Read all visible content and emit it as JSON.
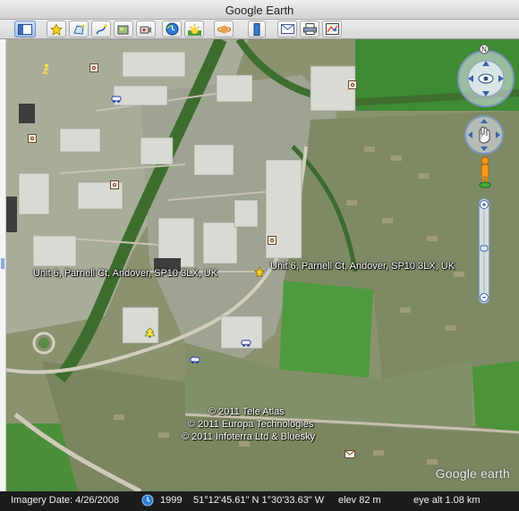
{
  "window": {
    "title": "Google Earth"
  },
  "toolbar": {
    "buttons": [
      {
        "name": "sidebar",
        "icon": "sidebar-icon"
      },
      {
        "name": "add-placemark",
        "icon": "pushpin-icon"
      },
      {
        "name": "add-polygon",
        "icon": "polygon-icon"
      },
      {
        "name": "add-path",
        "icon": "path-icon"
      },
      {
        "name": "add-image-overlay",
        "icon": "image-overlay-icon"
      },
      {
        "name": "record-tour",
        "icon": "record-tour-icon"
      },
      {
        "name": "historical-imagery",
        "icon": "historical-clock-icon"
      },
      {
        "name": "sunlight",
        "icon": "sun-icon"
      },
      {
        "name": "switch-planet",
        "icon": "planet-icon"
      },
      {
        "name": "ruler",
        "icon": "ruler-icon"
      },
      {
        "name": "email",
        "icon": "email-icon"
      },
      {
        "name": "print",
        "icon": "print-icon"
      },
      {
        "name": "view-in-maps",
        "icon": "maps-icon"
      }
    ]
  },
  "map": {
    "placemark_labels": [
      "Unit 6, Parnell Ct, Andover, SP10 3LX, UK",
      "Unit 6, Parnell Ct, Andover, SP10 3LX, UK"
    ],
    "copyright": [
      "© 2011 Tele Atlas",
      "© 2011 Europa Technologies",
      "© 2011 Infoterra Ltd & Bluesky"
    ],
    "logo_text": "Google earth",
    "compass_letter": "N"
  },
  "status": {
    "imagery_date": "Imagery Date: 4/26/2008",
    "year": "1999",
    "coordinates": "51°12'45.61\" N   1°30'33.63\" W",
    "elev": "elev   82 m",
    "eye_alt": "eye alt   1.08 km"
  },
  "colors": {
    "fields": "#3f8a35",
    "urban": "#9aa28a",
    "roads": "#c9c3b2",
    "statusbar": "#1c1c1c"
  }
}
